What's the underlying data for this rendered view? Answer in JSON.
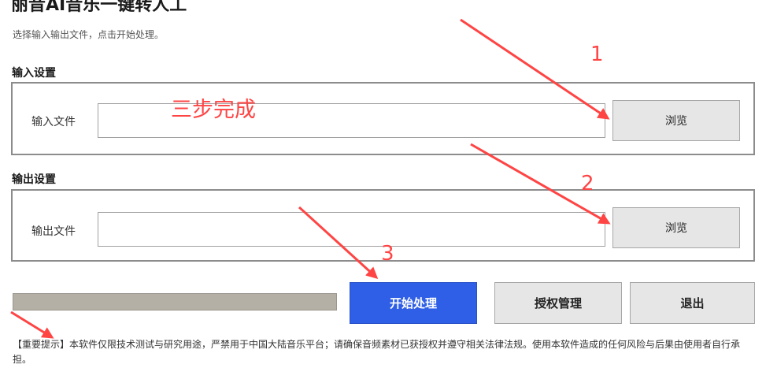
{
  "app": {
    "title": "丽音AI音乐一键转人工",
    "subtitle": "选择输入输出文件，点击开始处理。"
  },
  "input_section": {
    "title": "输入设置",
    "field_label": "输入文件",
    "value": "",
    "browse_label": "浏览"
  },
  "output_section": {
    "title": "输出设置",
    "field_label": "输出文件",
    "value": "",
    "browse_label": "浏览"
  },
  "progress": {
    "value": 0
  },
  "actions": {
    "start_label": "开始处理",
    "license_label": "授权管理",
    "exit_label": "退出"
  },
  "notice": "【重要提示】本软件仅限技术测试与研究用途，严禁用于中国大陆音乐平台；请确保音频素材已获授权并遵守相关法律法规。使用本软件造成的任何风险与后果由使用者自行承担。",
  "annotations": {
    "headline": "三步完成",
    "step1": "1",
    "step2": "2",
    "step3": "3",
    "color": "#ff4444"
  },
  "colors": {
    "primary": "#2f5fe6",
    "progress_track": "#b5b0a6",
    "border": "#8c8c8c"
  }
}
